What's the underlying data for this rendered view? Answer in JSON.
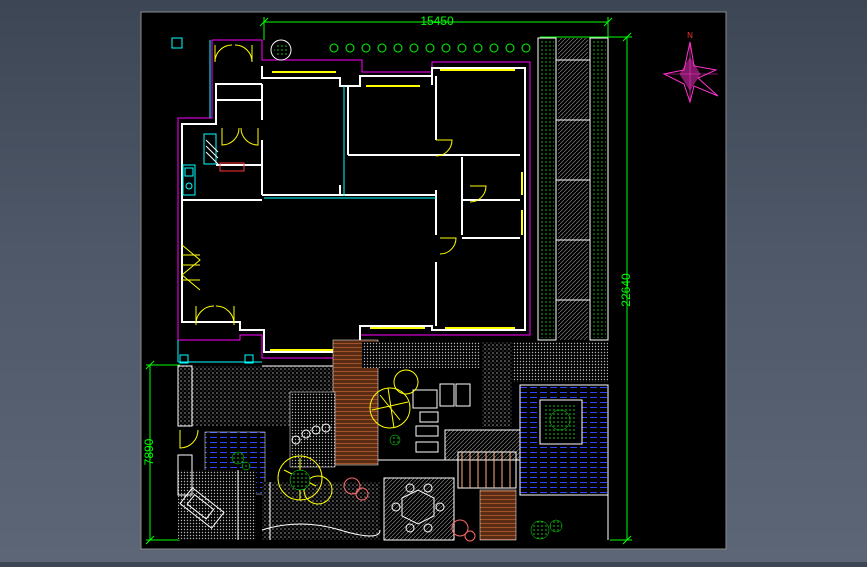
{
  "drawing": {
    "width_dimension": "15450",
    "height_dimension": "22640",
    "garden_dimension": "7890",
    "compass_label": "N"
  },
  "colors": {
    "background_outer": "#4e5868",
    "canvas": "#000000",
    "dimension": "#00ff00",
    "wall": "#ffffff",
    "wall_outline": "#ff00ff",
    "window": "#ffff00",
    "door": "#ffff00",
    "glass": "#00ffff",
    "paving": "#8a8a8a",
    "deck": "#a0522d",
    "water": "#1e3cff",
    "tree": "#ffff00",
    "shrub": "#00ff00",
    "compass": "#ff33cc"
  }
}
